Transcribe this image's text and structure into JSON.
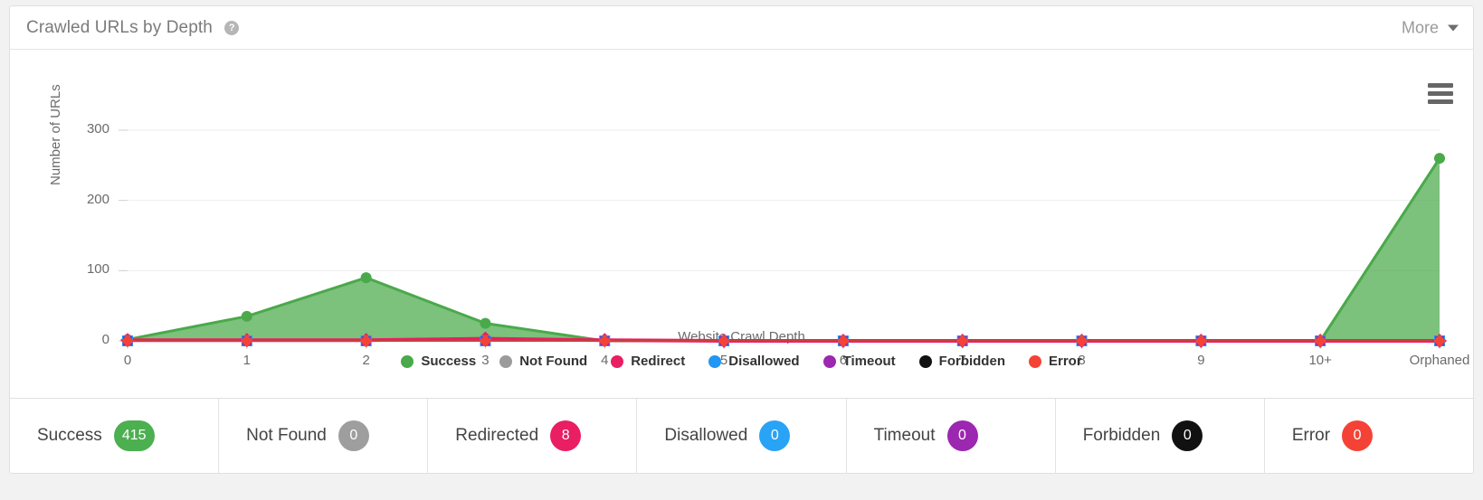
{
  "header": {
    "title": "Crawled URLs by Depth",
    "help_icon": "question-mark-icon",
    "more_label": "More",
    "caret_icon": "chevron-down-icon"
  },
  "chart_menu": {
    "icon": "hamburger-menu-icon"
  },
  "chart_data": {
    "type": "area",
    "title": "Crawled URLs by Depth",
    "xlabel": "Website Crawl Depth",
    "ylabel": "Number of URLs",
    "categories": [
      "0",
      "1",
      "2",
      "3",
      "4",
      "5",
      "6",
      "7",
      "8",
      "9",
      "10+",
      "Orphaned"
    ],
    "yticks": [
      0,
      100,
      200,
      300
    ],
    "ylim": [
      0,
      300
    ],
    "grid": true,
    "legend_position": "bottom",
    "series": [
      {
        "name": "Success",
        "color": "#4aa94a",
        "values": [
          2,
          35,
          90,
          25,
          0,
          0,
          0,
          0,
          0,
          0,
          0,
          260
        ]
      },
      {
        "name": "Not Found",
        "color": "#9b9b9b",
        "values": [
          0,
          0,
          0,
          0,
          0,
          0,
          0,
          0,
          0,
          0,
          0,
          0
        ]
      },
      {
        "name": "Redirect",
        "color": "#e91e63",
        "values": [
          1,
          1,
          1,
          3,
          1,
          0,
          0,
          0,
          0,
          0,
          0,
          0
        ]
      },
      {
        "name": "Disallowed",
        "color": "#2196f3",
        "values": [
          0,
          0,
          0,
          0,
          0,
          0,
          0,
          0,
          0,
          0,
          0,
          0
        ]
      },
      {
        "name": "Timeout",
        "color": "#9c27b0",
        "values": [
          0,
          0,
          0,
          0,
          0,
          0,
          0,
          0,
          0,
          0,
          0,
          0
        ]
      },
      {
        "name": "Forbidden",
        "color": "#111111",
        "values": [
          0,
          0,
          0,
          0,
          0,
          0,
          0,
          0,
          0,
          0,
          0,
          0
        ]
      },
      {
        "name": "Error",
        "color": "#f44336",
        "values": [
          0,
          0,
          0,
          0,
          0,
          0,
          0,
          0,
          0,
          0,
          0,
          0
        ]
      }
    ]
  },
  "legend": [
    {
      "label": "Success",
      "color": "#4aa94a"
    },
    {
      "label": "Not Found",
      "color": "#9b9b9b"
    },
    {
      "label": "Redirect",
      "color": "#e91e63"
    },
    {
      "label": "Disallowed",
      "color": "#2196f3"
    },
    {
      "label": "Timeout",
      "color": "#9c27b0"
    },
    {
      "label": "Forbidden",
      "color": "#111111"
    },
    {
      "label": "Error",
      "color": "#f44336"
    }
  ],
  "stats": [
    {
      "label": "Success",
      "value": "415",
      "color": "#4caf50"
    },
    {
      "label": "Not Found",
      "value": "0",
      "color": "#9e9e9e"
    },
    {
      "label": "Redirected",
      "value": "8",
      "color": "#e91e63"
    },
    {
      "label": "Disallowed",
      "value": "0",
      "color": "#29a3f5"
    },
    {
      "label": "Timeout",
      "value": "0",
      "color": "#9c27b0"
    },
    {
      "label": "Forbidden",
      "value": "0",
      "color": "#111111"
    },
    {
      "label": "Error",
      "value": "0",
      "color": "#f44336"
    }
  ]
}
